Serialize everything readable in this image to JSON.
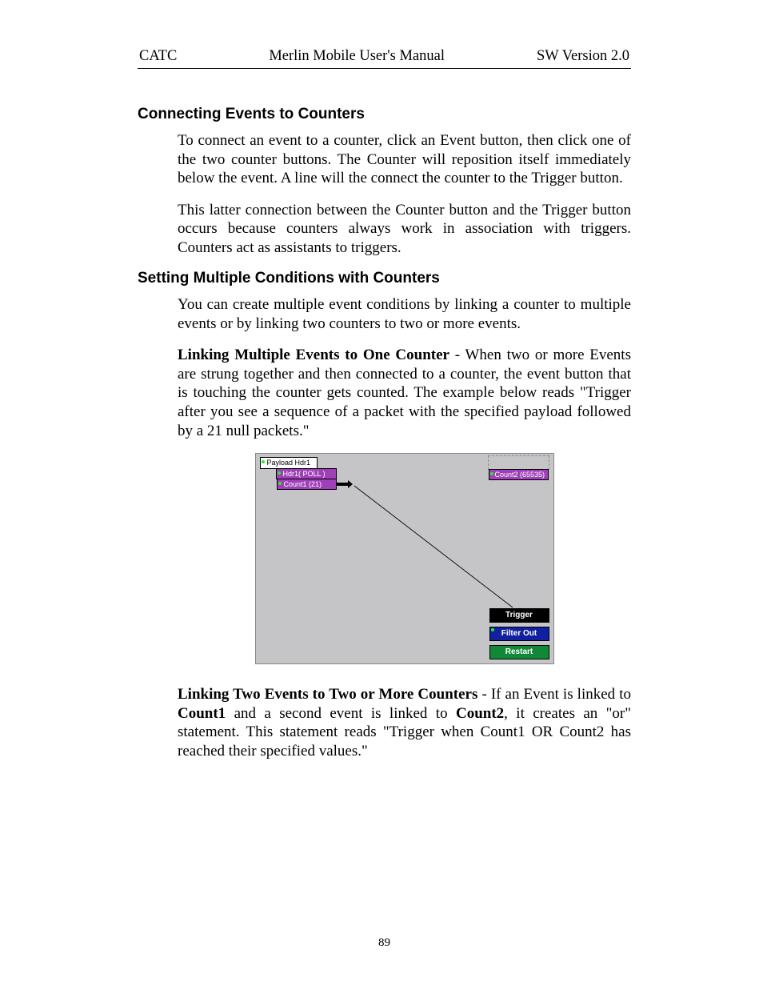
{
  "header": {
    "left": "CATC",
    "center": "Merlin Mobile User's Manual",
    "right": "SW Version 2.0"
  },
  "section1": {
    "heading": "Connecting Events to Counters",
    "p1": "To connect an event to a counter, click an Event button, then click one of the two counter buttons.  The Counter will reposition itself immediately below the event.  A line will the connect the counter to the Trigger button.",
    "p2": "This latter connection between the Counter button and the Trigger button occurs because counters always work in association with triggers.  Counters act as assistants to triggers."
  },
  "section2": {
    "heading": "Setting Multiple Conditions with Counters",
    "p1": "You can create multiple event conditions by linking a counter to multiple events or by linking two counters to two or more events.",
    "p2_lead": "Linking Multiple Events to One Counter",
    "p2_rest": " - When two or more Events are strung together and then connected to a counter, the event button that is touching the counter gets counted.  The example below reads \"Trigger after you see a sequence of a packet with the specified payload followed by a 21 null packets.\"",
    "p3_lead": "Linking Two Events to Two or More Counters",
    "p3_mid1": " - If an Event is linked to ",
    "p3_b1": "Count1",
    "p3_mid2": " and a second event is linked to ",
    "p3_b2": "Count2",
    "p3_rest": ", it creates an \"or\" statement.  This statement reads \"Trigger when Count1 OR Count2 has reached their specified values.\""
  },
  "figure": {
    "payload": "Payload Hdr1",
    "poll": "Hdr1( POLL )",
    "count1": "Count1 (21)",
    "count2": "Count2 (65535)",
    "trigger": "Trigger",
    "filter": "Filter Out",
    "restart": "Restart"
  },
  "page_number": "89"
}
